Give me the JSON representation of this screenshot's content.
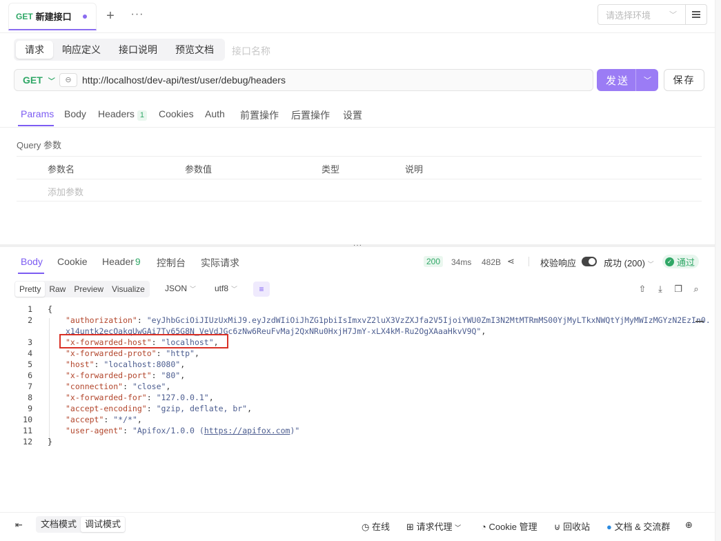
{
  "tab": {
    "method": "GET",
    "title": "新建接口"
  },
  "env": {
    "placeholder": "请选择环境"
  },
  "subtabs": [
    "请求",
    "响应定义",
    "接口说明",
    "预览文档"
  ],
  "name_placeholder": "接口名称",
  "request": {
    "method": "GET",
    "url": "http://localhost/dev-api/test/user/debug/headers",
    "send_label": "发送",
    "save_label": "保存"
  },
  "param_tabs": {
    "params": "Params",
    "body": "Body",
    "headers": "Headers",
    "headers_count": "1",
    "cookies": "Cookies",
    "auth": "Auth",
    "pre": "前置操作",
    "post": "后置操作",
    "settings": "设置"
  },
  "query": {
    "label": "Query 参数",
    "columns": [
      "参数名",
      "参数值",
      "类型",
      "说明"
    ],
    "add_placeholder": "添加参数"
  },
  "response_tabs": {
    "body": "Body",
    "cookie": "Cookie",
    "header": "Header",
    "header_count": "9",
    "console": "控制台",
    "actual": "实际请求"
  },
  "response_meta": {
    "status": "200",
    "time": "34ms",
    "size": "482B",
    "verify_label": "校验响应",
    "success_label": "成功 (200)",
    "pass_label": "通过"
  },
  "view": {
    "modes": [
      "Pretty",
      "Raw",
      "Preview",
      "Visualize"
    ],
    "format": "JSON",
    "encoding": "utf8"
  },
  "code": {
    "line_numbers": [
      "1",
      "2",
      "",
      "3",
      "4",
      "5",
      "6",
      "7",
      "8",
      "9",
      "10",
      "11",
      "12"
    ],
    "open": "{",
    "close": "}",
    "auth_key": "\"authorization\"",
    "auth_val1": "\"eyJhbGciOiJIUzUxMiJ9.eyJzdWIiOiJhZG1pbiIsImxvZ2luX3VzZXJfa2V5IjoiYWU0ZmI3N2MtMTRmMS00YjMyLTkxNWQtYjMyMWIzMGYzN2EzIn0.",
    "auth_val2": "x14untk2ecOakqUwGAi7Tv65G8N_VeVdJGc6zNw6ReuFvMaj2QxNRu0HxjH7JmY-xLX4kM-Ru2OgXAaaHkvV9Q\"",
    "rows": [
      {
        "k": "\"x-forwarded-host\"",
        "v": "\"localhost\""
      },
      {
        "k": "\"x-forwarded-proto\"",
        "v": "\"http\""
      },
      {
        "k": "\"host\"",
        "v": "\"localhost:8080\""
      },
      {
        "k": "\"x-forwarded-port\"",
        "v": "\"80\""
      },
      {
        "k": "\"connection\"",
        "v": "\"close\""
      },
      {
        "k": "\"x-forwarded-for\"",
        "v": "\"127.0.0.1\""
      },
      {
        "k": "\"accept-encoding\"",
        "v": "\"gzip, deflate, br\""
      },
      {
        "k": "\"accept\"",
        "v": "\"*/*\""
      }
    ],
    "ua_key": "\"user-agent\"",
    "ua_val_pre": "\"Apifox/1.0.0 (",
    "ua_link": "https://apifox.com",
    "ua_val_post": ")\""
  },
  "bottom": {
    "doc_mode": "文档模式",
    "debug_mode": "调试模式",
    "online": "在线",
    "proxy": "请求代理",
    "cookie": "Cookie 管理",
    "recycle": "回收站",
    "community": "文档 & 交流群"
  }
}
